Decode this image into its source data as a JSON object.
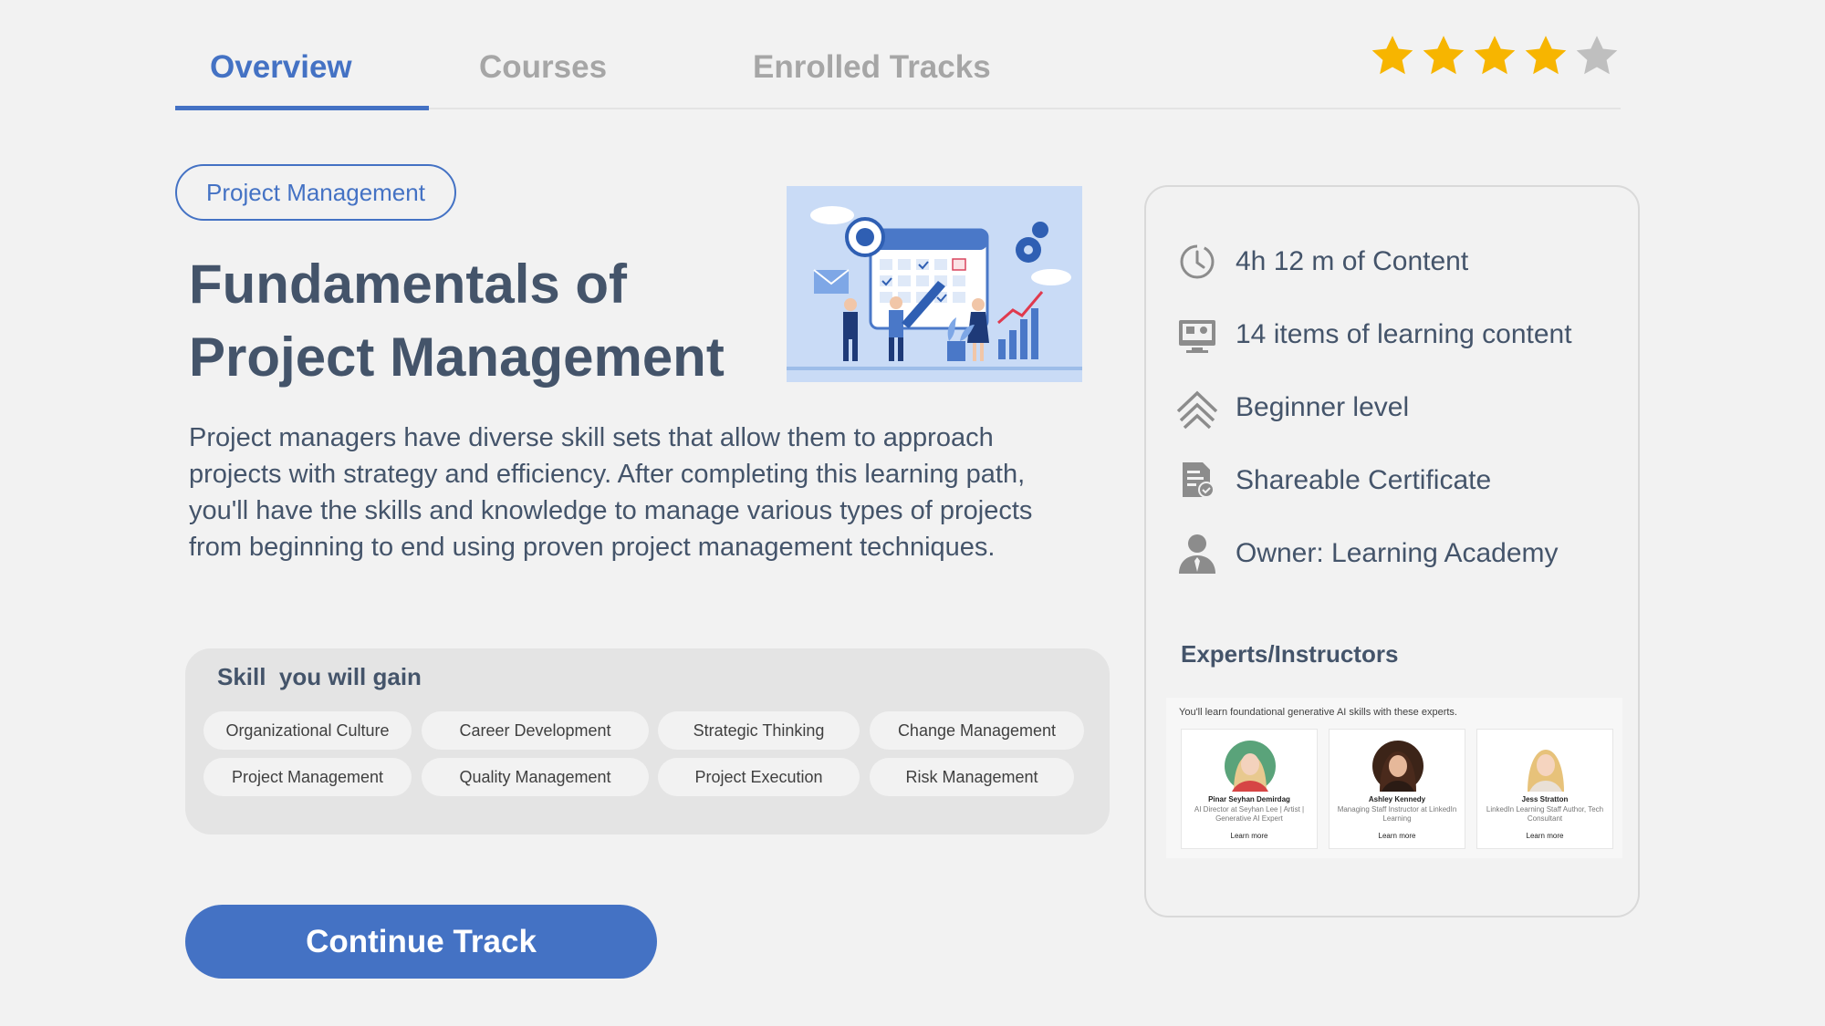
{
  "tabs": [
    {
      "label": "Overview",
      "active": true
    },
    {
      "label": "Courses",
      "active": false
    },
    {
      "label": "Enrolled Tracks",
      "active": false
    }
  ],
  "rating": {
    "value": 4,
    "max": 5,
    "color_filled": "#f7b500",
    "color_empty": "#bfbfbf"
  },
  "category": "Project Management",
  "title_line1": "Fundamentals of",
  "title_line2": "Project Management",
  "hero_icon": "project-planning-illustration",
  "description": "Project managers have diverse skill sets that allow them to approach projects with strategy and efficiency. After completing this learning path, you'll have the skills and knowledge to manage various types of projects from beginning to end using proven project management techniques.",
  "skills": {
    "title": "Skill  you will gain",
    "items": [
      "Organizational Culture",
      "Career Development",
      "Strategic Thinking",
      "Change Management",
      "Project Management",
      "Quality Management",
      "Project Execution",
      "Risk Management"
    ]
  },
  "continue_label": "Continue Track",
  "info": [
    {
      "icon": "clock-icon",
      "text": "4h 12 m of Content"
    },
    {
      "icon": "monitor-icon",
      "text": "14 items of learning content"
    },
    {
      "icon": "level-chevrons-icon",
      "text": "Beginner level"
    },
    {
      "icon": "certificate-icon",
      "text": "Shareable Certificate"
    },
    {
      "icon": "user-icon",
      "text": "Owner: Learning Academy"
    }
  ],
  "experts": {
    "title": "Experts/Instructors",
    "intro": "You'll learn foundational generative AI skills with these experts.",
    "people": [
      {
        "name": "Pinar Seyhan Demirdag",
        "role": "AI Director at Seyhan Lee | Artist | Generative AI Expert",
        "link": "Learn more"
      },
      {
        "name": "Ashley Kennedy",
        "role": "Managing Staff Instructor at LinkedIn Learning",
        "link": "Learn more"
      },
      {
        "name": "Jess Stratton",
        "role": "LinkedIn Learning Staff Author, Tech Consultant",
        "link": "Learn more"
      }
    ]
  },
  "colors": {
    "accent": "#4472c4",
    "text": "#44546a",
    "background": "#f2f2f2"
  }
}
